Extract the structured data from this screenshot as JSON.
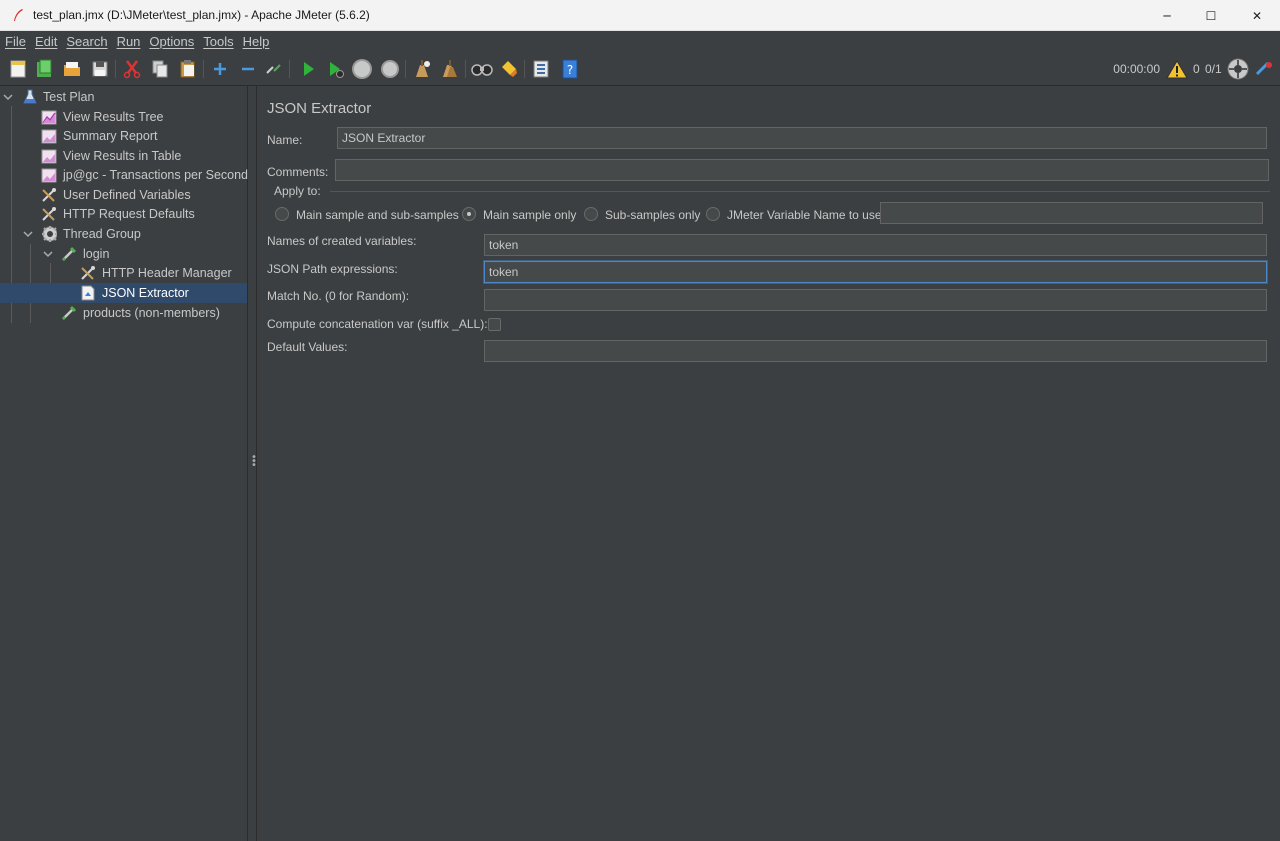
{
  "window": {
    "title": "test_plan.jmx (D:\\JMeter\\test_plan.jmx) - Apache JMeter (5.6.2)",
    "controls": {
      "minimize": "─",
      "maximize": "☐",
      "close": "✕"
    }
  },
  "menu": {
    "items": [
      "File",
      "Edit",
      "Search",
      "Run",
      "Options",
      "Tools",
      "Help"
    ]
  },
  "toolbar": {
    "timer": "00:00:00",
    "warnings": "0",
    "threads": "0/1",
    "buttons": [
      "new",
      "templates",
      "open",
      "save",
      "cut",
      "copy",
      "paste",
      "expand",
      "collapse",
      "toggle",
      "start",
      "start-no-pauses",
      "stop",
      "shutdown",
      "clear",
      "clear-all",
      "search",
      "reset-search",
      "function-helper",
      "help"
    ]
  },
  "tree": {
    "items": [
      {
        "label": "Test Plan",
        "icon": "test-plan-icon",
        "expanded": true
      },
      {
        "label": "View Results Tree",
        "icon": "listener-icon"
      },
      {
        "label": "Summary Report",
        "icon": "listener-icon"
      },
      {
        "label": "View Results in Table",
        "icon": "listener-icon"
      },
      {
        "label": "jp@gc - Transactions per Second",
        "icon": "listener-icon"
      },
      {
        "label": "User Defined Variables",
        "icon": "config-icon"
      },
      {
        "label": "HTTP Request Defaults",
        "icon": "config-icon"
      },
      {
        "label": "Thread Group",
        "icon": "thread-group-icon",
        "expanded": true
      },
      {
        "label": "login",
        "icon": "sampler-icon",
        "expanded": true
      },
      {
        "label": "HTTP Header Manager",
        "icon": "config-icon"
      },
      {
        "label": "JSON Extractor",
        "icon": "post-processor-icon",
        "selected": true
      },
      {
        "label": "products (non-members)",
        "icon": "sampler-icon"
      }
    ]
  },
  "editor": {
    "title": "JSON Extractor",
    "name_label": "Name:",
    "name_value": "JSON Extractor",
    "comments_label": "Comments:",
    "comments_value": "",
    "apply_to": {
      "legend": "Apply to:",
      "options": [
        "Main sample and sub-samples",
        "Main sample only",
        "Sub-samples only",
        "JMeter Variable Name to use"
      ],
      "selected": "Main sample only",
      "variable_value": ""
    },
    "names_label": "Names of created variables:",
    "names_value": "token",
    "path_label": "JSON Path expressions:",
    "path_value": "token",
    "match_label": "Match No. (0 for Random):",
    "match_value": "",
    "concat_label": "Compute concatenation var (suffix _ALL):",
    "concat_checked": false,
    "default_label": "Default Values:",
    "default_value": ""
  },
  "colors": {
    "background": "#3c3f41",
    "selection": "#2f4a6b",
    "field": "#45494a",
    "focus": "#4a88c7"
  }
}
